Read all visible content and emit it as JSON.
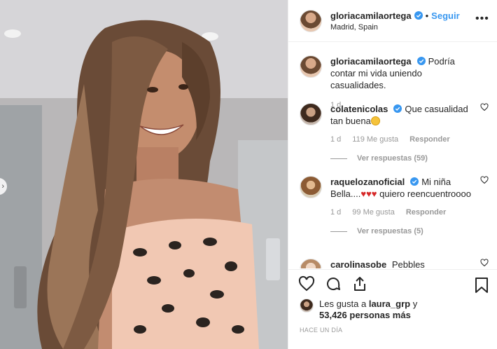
{
  "post": {
    "username": "gloriacamilaortega",
    "follow_label": "Seguir",
    "location": "Madrid, Spain",
    "more_icon": "more-horizontal-icon"
  },
  "caption": {
    "username": "gloriacamilaortega",
    "text": "Podría contar mi vida uniendo casualidades.",
    "time": "1 d"
  },
  "comments": [
    {
      "username": "colatenicolas",
      "text": "Que casualidad tan buena",
      "time": "1 d",
      "likes": "119 Me gusta",
      "reply_label": "Responder",
      "view_replies": "Ver respuestas (59)"
    },
    {
      "username": "raquelozanoficial",
      "text_a": "Mi niña Bella....",
      "text_b": "quiero reencuentroooo",
      "time": "1 d",
      "likes": "99 Me gusta",
      "reply_label": "Responder",
      "view_replies": "Ver respuestas (5)"
    },
    {
      "username": "carolinasobe",
      "text": "Pebbles"
    }
  ],
  "likes": {
    "prefix": "Les gusta a",
    "user": "laura_grp",
    "joiner": "y",
    "count": "53,426 personas más"
  },
  "time_ago": "HACE UN DÍA",
  "colors": {
    "accent": "#3897f0",
    "verified": "#3897f0",
    "text": "#262626",
    "muted": "#999999"
  }
}
